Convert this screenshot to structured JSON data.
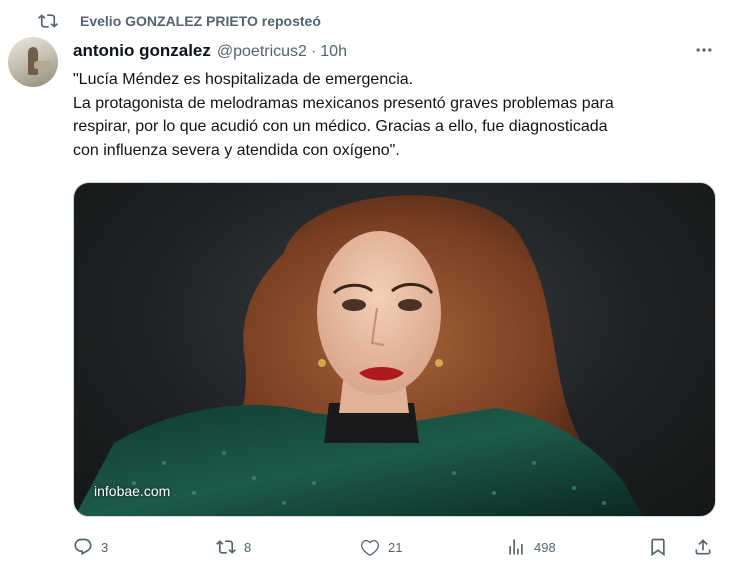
{
  "repost_banner": {
    "text": "Evelio GONZALEZ PRIETO reposteó",
    "icon": "repost-icon"
  },
  "author": {
    "name": "antonio gonzalez",
    "handle": "@poetricus2",
    "separator": "·",
    "time": "10h"
  },
  "tweet": {
    "lines": [
      "\"Lucía Méndez es hospitalizada de emergencia.",
      "La protagonista de melodramas mexicanos presentó graves problemas para",
      "respirar, por lo que acudió con un médico. Gracias a ello, fue diagnosticada",
      "con influenza severa y atendida con oxígeno\"."
    ]
  },
  "media": {
    "watermark": "infobae.com"
  },
  "actions": {
    "replies": "3",
    "reposts": "8",
    "likes": "21",
    "views": "498"
  },
  "colors": {
    "text": "#0f1419",
    "muted": "#536471",
    "border": "#cfd9de"
  }
}
